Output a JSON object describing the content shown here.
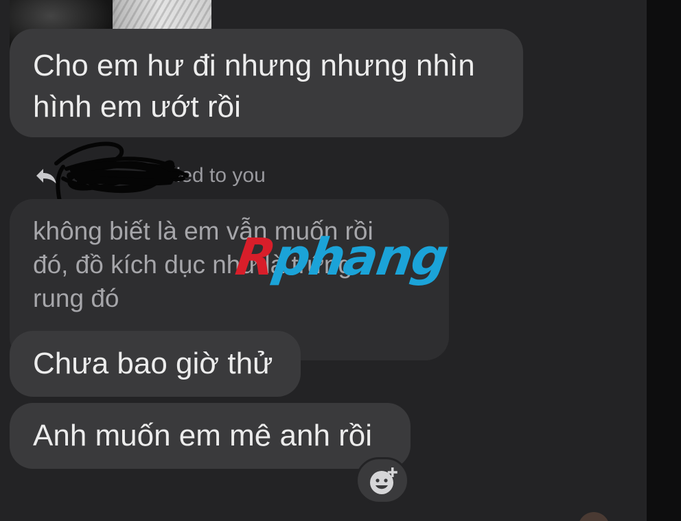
{
  "messages": {
    "msg1": {
      "line1": "Cho em hư đi nhưng nhưng nhìn",
      "line2": "hình em ướt rồi"
    },
    "reply_header": {
      "text": "…lied to you"
    },
    "quoted": {
      "line1": "không biết là em vẫn muốn rồi",
      "line2": "đó, đồ kích dục như là trứng",
      "line3": "rung đó"
    },
    "msg2": "Chưa bao giờ thử",
    "msg3": "Anh muốn em mê anh rồi"
  },
  "watermark": {
    "first": "R",
    "rest": "phang"
  },
  "icons": {
    "reply": "reply-arrow-icon",
    "react": "add-reaction-icon"
  },
  "colors": {
    "background": "#232325",
    "bubble": "#3a3a3c",
    "quote_bubble": "#2e2e30",
    "watermark_red": "#d81e2a",
    "watermark_blue": "#1ba3d8"
  }
}
